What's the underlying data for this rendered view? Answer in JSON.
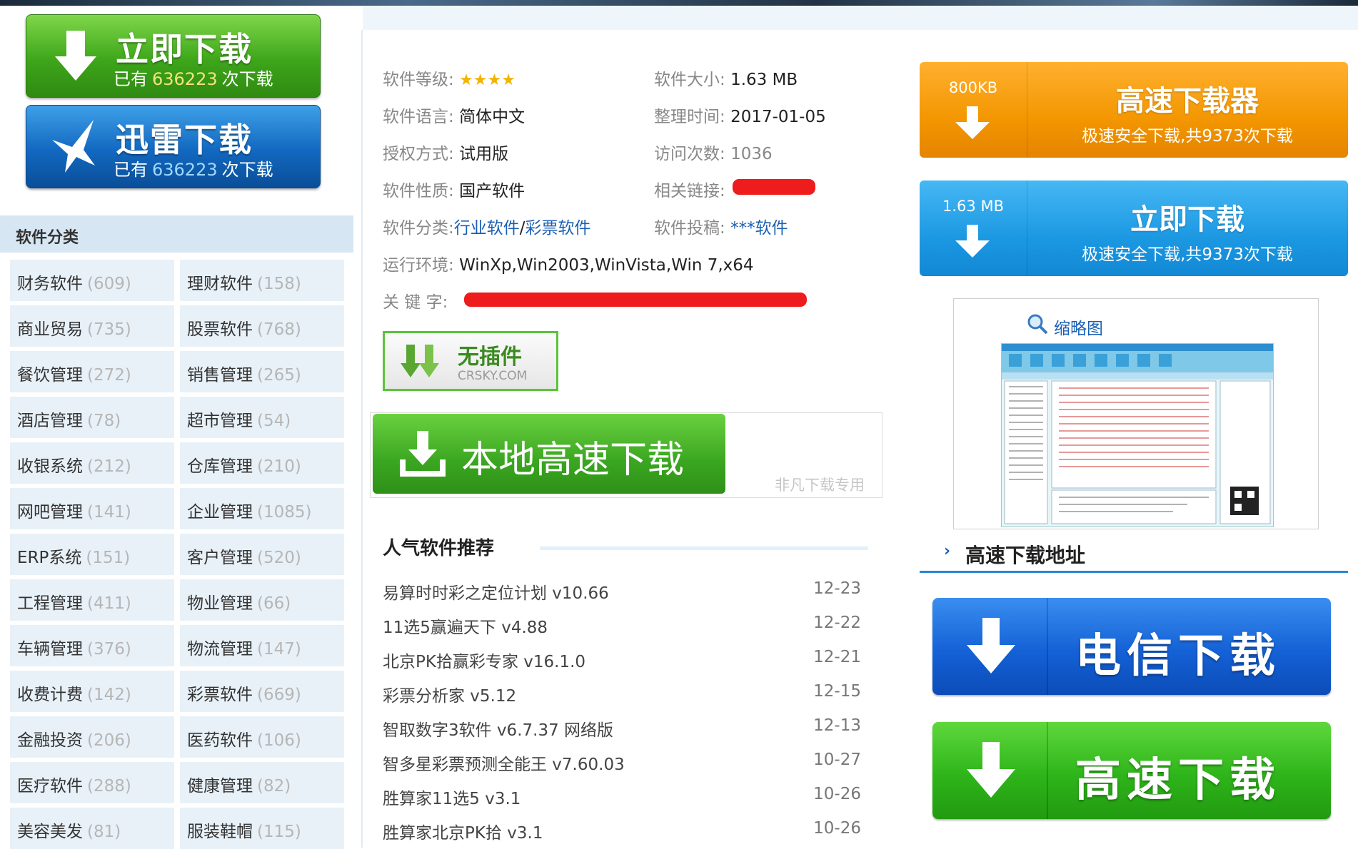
{
  "left": {
    "download_now": {
      "title": "立即下载",
      "prefix": "已有",
      "count": "636223",
      "suffix": "次下载"
    },
    "xunlei_download": {
      "title": "迅雷下载",
      "prefix": "已有",
      "count": "636223",
      "suffix": "次下载"
    },
    "category_heading": "软件分类",
    "categories": [
      {
        "name": "财务软件",
        "count": "(609)"
      },
      {
        "name": "理财软件",
        "count": "(158)"
      },
      {
        "name": "商业贸易",
        "count": "(735)"
      },
      {
        "name": "股票软件",
        "count": "(768)"
      },
      {
        "name": "餐饮管理",
        "count": "(272)"
      },
      {
        "name": "销售管理",
        "count": "(265)"
      },
      {
        "name": "酒店管理",
        "count": "(78)"
      },
      {
        "name": "超市管理",
        "count": "(54)"
      },
      {
        "name": "收银系统",
        "count": "(212)"
      },
      {
        "name": "仓库管理",
        "count": "(210)"
      },
      {
        "name": "网吧管理",
        "count": "(141)"
      },
      {
        "name": "企业管理",
        "count": "(1085)"
      },
      {
        "name": "ERP系统",
        "count": "(151)"
      },
      {
        "name": "客户管理",
        "count": "(520)"
      },
      {
        "name": "工程管理",
        "count": "(411)"
      },
      {
        "name": "物业管理",
        "count": "(66)"
      },
      {
        "name": "车辆管理",
        "count": "(376)"
      },
      {
        "name": "物流管理",
        "count": "(147)"
      },
      {
        "name": "收费计费",
        "count": "(142)"
      },
      {
        "name": "彩票软件",
        "count": "(669)"
      },
      {
        "name": "金融投资",
        "count": "(206)"
      },
      {
        "name": "医药软件",
        "count": "(106)"
      },
      {
        "name": "医疗软件",
        "count": "(288)"
      },
      {
        "name": "健康管理",
        "count": "(82)"
      },
      {
        "name": "美容美发",
        "count": "(81)"
      },
      {
        "name": "服装鞋帽",
        "count": "(115)"
      }
    ]
  },
  "info": {
    "level_label": "软件等级:",
    "level_stars": 4,
    "size_label": "软件大小:",
    "size_value": "1.63 MB",
    "lang_label": "软件语言:",
    "lang_value": "简体中文",
    "date_label": "整理时间:",
    "date_value": "2017-01-05",
    "license_label": "授权方式:",
    "license_value": "试用版",
    "visits_label": "访问次数:",
    "visits_value": "1036",
    "nature_label": "软件性质:",
    "nature_value": "国产软件",
    "link_label": "相关链接:",
    "cat_label": "软件分类:",
    "cat_link1": "行业软件",
    "cat_sep": "/",
    "cat_link2": "彩票软件",
    "submit_label": "软件投稿:",
    "submit_value": "***软件",
    "env_label": "运行环境:",
    "env_value": "WinXp,Win2003,WinVista,Win 7,x64",
    "keyword_label": "关 键 字:"
  },
  "no_plugin": {
    "title": "无插件",
    "site": "CRSKY.COM"
  },
  "local_download": {
    "label": "本地高速下载",
    "note": "非凡下载专用"
  },
  "recommend": {
    "heading": "人气软件推荐",
    "items": [
      {
        "name": "易算时时彩之定位计划 v10.66",
        "date": "12-23"
      },
      {
        "name": "11选5赢遍天下 v4.88",
        "date": "12-22"
      },
      {
        "name": "北京PK拾赢彩专家 v16.1.0",
        "date": "12-21"
      },
      {
        "name": "彩票分析家 v5.12",
        "date": "12-15"
      },
      {
        "name": "智取数字3软件 v6.7.37 网络版",
        "date": "12-13"
      },
      {
        "name": "智多星彩票预测全能王 v7.60.03",
        "date": "10-27"
      },
      {
        "name": "胜算家11选5 v3.1",
        "date": "10-26"
      },
      {
        "name": "胜算家北京PK拾 v3.1",
        "date": "10-26"
      }
    ]
  },
  "right": {
    "fast_downloader": {
      "size": "800KB",
      "title": "高速下载器",
      "sub": "极速安全下载,共9373次下载"
    },
    "instant_download": {
      "size": "1.63 MB",
      "title": "立即下载",
      "sub": "极速安全下载,共9373次下载"
    },
    "thumbnail_label": "缩略图",
    "address_heading": "高速下载地址",
    "telecom_download": "电信下载",
    "highspeed_download": "高速下载"
  },
  "colors": {
    "green": "#3ea61a",
    "blue": "#1268c0",
    "orange": "#f39600",
    "link": "#1a5fb4",
    "redaction": "#ee1c1c"
  }
}
